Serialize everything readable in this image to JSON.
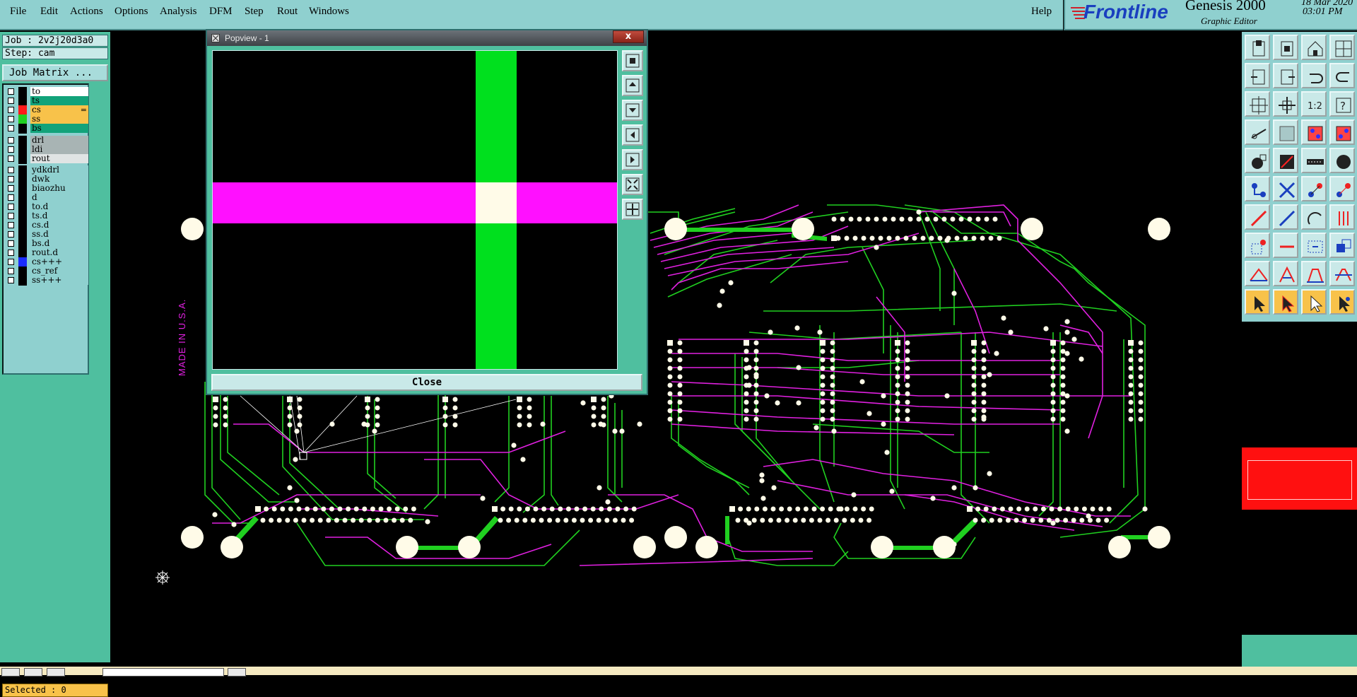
{
  "menu": {
    "items": [
      "File",
      "Edit",
      "Actions",
      "Options",
      "Analysis",
      "DFM",
      "Step",
      "Rout",
      "Windows"
    ],
    "help": "Help"
  },
  "brand": {
    "logo_text": "Frontline",
    "product": "Genesis 2000",
    "subtitle": "Graphic Editor",
    "date": "18 Mar 2020",
    "time": "03:01 PM"
  },
  "job_info": {
    "job": "Job : 2v2j20d3a0",
    "step": "Step: cam",
    "matrix_button": "Job Matrix ..."
  },
  "layers": [
    {
      "name": "to",
      "bg": "#ffffff",
      "swatch": "#000000",
      "marker": ""
    },
    {
      "name": "ts",
      "bg": "#12a37a",
      "swatch": "#000000",
      "marker": ""
    },
    {
      "name": "cs",
      "bg": "#f8c24a",
      "swatch": "#ff1a1a",
      "marker": "="
    },
    {
      "name": "ss",
      "bg": "#f8c24a",
      "swatch": "#20d020",
      "marker": ""
    },
    {
      "name": "bs",
      "bg": "#12a37a",
      "swatch": "#000000",
      "marker": ""
    },
    {
      "name": "drl",
      "bg": "#a8b4b4",
      "swatch": "#000000",
      "marker": ""
    },
    {
      "name": "ldi",
      "bg": "#a8b4b4",
      "swatch": "#000000",
      "marker": ""
    },
    {
      "name": "rout",
      "bg": "#e0e4e4",
      "swatch": "#000000",
      "marker": ""
    },
    {
      "name": "ydkdrl",
      "bg": "#8fd0cf",
      "swatch": "#000000",
      "marker": ""
    },
    {
      "name": "dwk",
      "bg": "#8fd0cf",
      "swatch": "#000000",
      "marker": ""
    },
    {
      "name": "biaozhu",
      "bg": "#8fd0cf",
      "swatch": "#000000",
      "marker": ""
    },
    {
      "name": "d",
      "bg": "#8fd0cf",
      "swatch": "#000000",
      "marker": ""
    },
    {
      "name": "to.d",
      "bg": "#8fd0cf",
      "swatch": "#000000",
      "marker": ""
    },
    {
      "name": "ts.d",
      "bg": "#8fd0cf",
      "swatch": "#000000",
      "marker": ""
    },
    {
      "name": "cs.d",
      "bg": "#8fd0cf",
      "swatch": "#000000",
      "marker": ""
    },
    {
      "name": "ss.d",
      "bg": "#8fd0cf",
      "swatch": "#000000",
      "marker": ""
    },
    {
      "name": "bs.d",
      "bg": "#8fd0cf",
      "swatch": "#000000",
      "marker": ""
    },
    {
      "name": "rout.d",
      "bg": "#8fd0cf",
      "swatch": "#000000",
      "marker": ""
    },
    {
      "name": "cs+++",
      "bg": "#8fd0cf",
      "swatch": "#1a2cff",
      "marker": ""
    },
    {
      "name": "cs_ref",
      "bg": "#8fd0cf",
      "swatch": "#000000",
      "marker": ""
    },
    {
      "name": "ss+++",
      "bg": "#8fd0cf",
      "swatch": "#000000",
      "marker": ""
    }
  ],
  "selected": "Selected : 0",
  "popview": {
    "title": "Popview - 1",
    "close_x": "x",
    "close_button": "Close"
  },
  "board_text": "MADE IN U.S.A.",
  "toolbox": {
    "icons": [
      "zoom-home-icon",
      "zoom-out-icon",
      "home-icon",
      "split-view-icon",
      "pan-left-icon",
      "pan-right-icon",
      "undo-icon",
      "redo-icon",
      "fit-icon",
      "zoom-fit-icon",
      "scale-1-2-icon",
      "help-icon",
      "snap-icon",
      "grid-icon",
      "connect-icon",
      "connect2-icon",
      "pad-icon",
      "surface-icon",
      "measure-icon",
      "circle-icon",
      "add-node-icon",
      "cross-icon",
      "move-point-icon",
      "line-point-icon",
      "line-icon",
      "line2-icon",
      "arc-icon",
      "pins-icon",
      "select-pad-icon",
      "line3-icon",
      "resize-icon",
      "copy-icon",
      "triangle-icon",
      "triangle2-icon",
      "angle-icon",
      "angle2-icon",
      "pointer-icon",
      "pointer2-icon",
      "pointer3-icon",
      "pointer4-icon"
    ]
  },
  "colors": {
    "panel": "#8fd0cf",
    "panel_dark": "#4fbf9f",
    "trace_green": "#20d020",
    "trace_magenta": "#e020e0",
    "pad": "#fffbe8",
    "highlight": "#ff1010"
  }
}
